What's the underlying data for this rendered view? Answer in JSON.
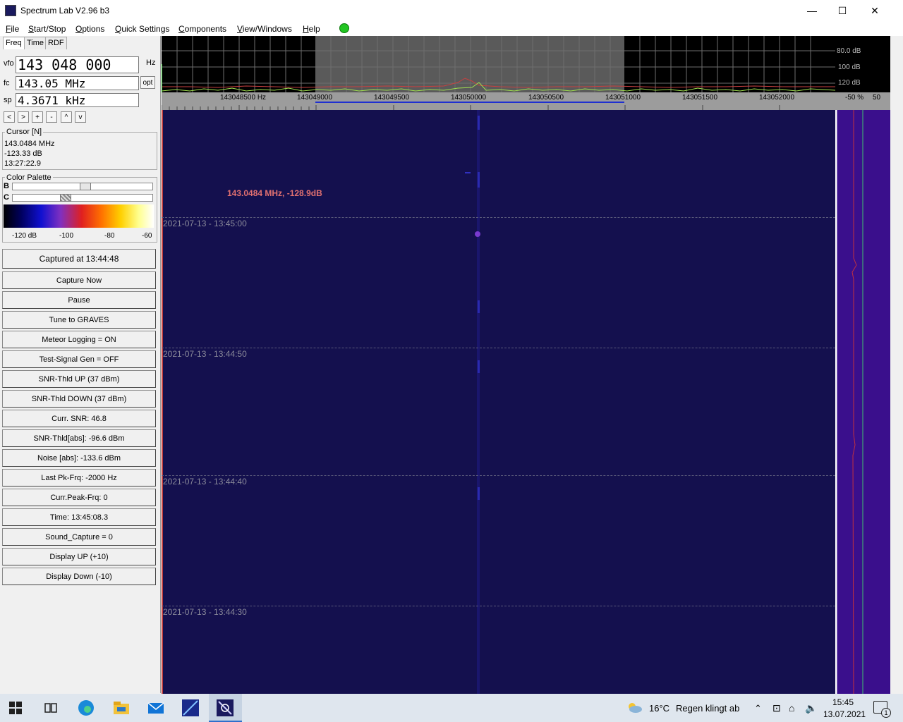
{
  "window": {
    "title": "Spectrum Lab V2.96 b3"
  },
  "controls": {
    "minimize": "—",
    "maximize": "☐",
    "close": "✕"
  },
  "menu": [
    "File",
    "Start/Stop",
    "Options",
    "Quick Settings",
    "Components",
    "View/Windows",
    "Help"
  ],
  "tabs": [
    "Freq",
    "Time",
    "RDF"
  ],
  "freq": {
    "vfo_label": "vfo",
    "vfo_value": "143 048 000",
    "vfo_unit": "Hz",
    "fc_label": "fc",
    "fc_value": "143.05 MHz",
    "fc_opt": "opt",
    "sp_label": "sp",
    "sp_value": "4.3671 kHz"
  },
  "nav_buttons": [
    "<",
    ">",
    "+",
    "-",
    "^",
    "v"
  ],
  "cursor": {
    "title": "Cursor [N]",
    "lines": [
      "143.0484 MHz",
      "-123.33 dB",
      "13:27:22.9"
    ]
  },
  "palette": {
    "title": "Color Palette",
    "b_label": "B",
    "c_label": "C",
    "scale": [
      "-120 dB",
      "-100",
      "-80",
      "-60"
    ]
  },
  "buttons": [
    "Captured at 13:44:48",
    "Capture Now",
    "Pause",
    "Tune to GRAVES",
    "Meteor Logging = ON",
    "Test-Signal Gen = OFF",
    "SNR-Thld UP (37 dBm)",
    "SNR-Thld DOWN (37 dBm)",
    "Curr. SNR: 46.8",
    "SNR-Thld[abs]: -96.6 dBm",
    "Noise [abs]: -133.6 dBm",
    "Last Pk-Frq: -2000 Hz",
    "Curr.Peak-Frq: 0",
    "Time:  13:45:08.3",
    "Sound_Capture = 0",
    "Display UP (+10)",
    "Display Down (-10)"
  ],
  "spectrum": {
    "db_labels": [
      "80.0 dB",
      "100 dB",
      "120 dB"
    ],
    "freq_ticks": [
      "143048500 Hz",
      "143049000",
      "143049500",
      "143050000",
      "143050500",
      "143051000",
      "143051500",
      "143052000"
    ],
    "side_scale": [
      "-50 %",
      "50"
    ]
  },
  "waterfall": {
    "marker_label": "143.0484 MHz, -128.9dB",
    "time_labels": [
      "2021-07-13 - 13:45:00",
      "2021-07-13 - 13:44:50",
      "2021-07-13 - 13:44:40",
      "2021-07-13 - 13:44:30"
    ]
  },
  "taskbar": {
    "weather_temp": "16°C",
    "weather_text": "Regen klingt ab",
    "time": "15:45",
    "date": "13.07.2021",
    "notif_count": "1"
  }
}
